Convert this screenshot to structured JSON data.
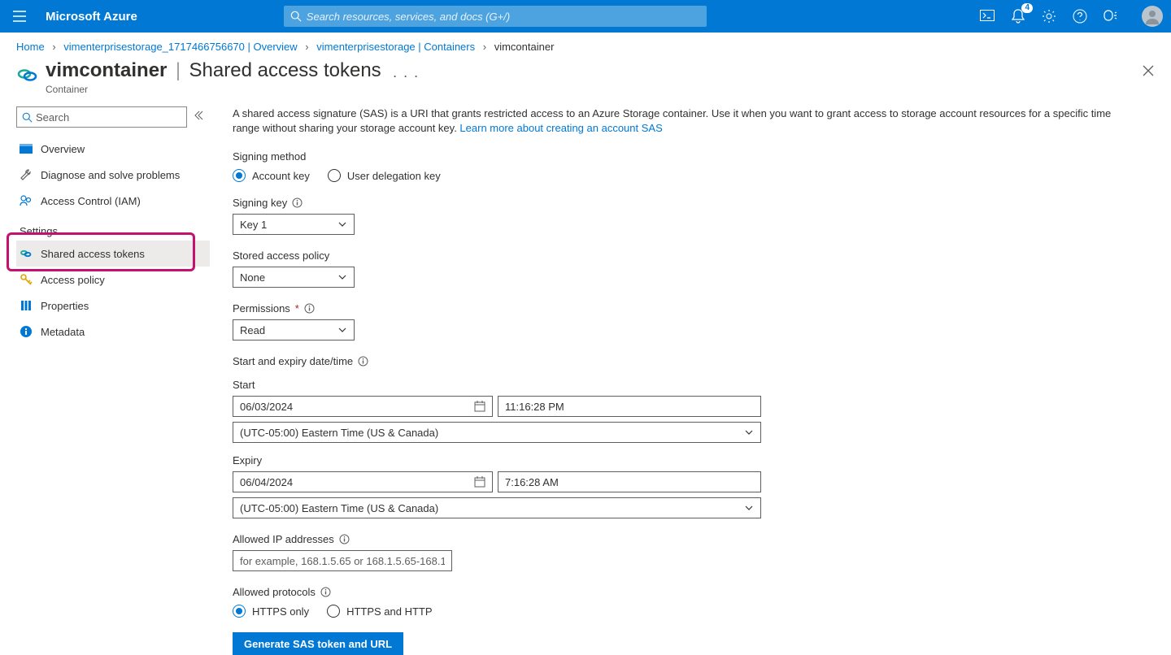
{
  "header": {
    "brand": "Microsoft Azure",
    "search_placeholder": "Search resources, services, and docs (G+/)",
    "notification_count": "4"
  },
  "breadcrumb": {
    "items": [
      "Home",
      "vimenterprisestorage_1717466756670 | Overview",
      "vimenterprisestorage | Containers",
      "vimcontainer"
    ]
  },
  "title": {
    "resource": "vimcontainer",
    "page": "Shared access tokens",
    "subtitle": "Container"
  },
  "sidebar": {
    "search_placeholder": "Search",
    "items_top": [
      {
        "label": "Overview"
      },
      {
        "label": "Diagnose and solve problems"
      },
      {
        "label": "Access Control (IAM)"
      }
    ],
    "group_label": "Settings",
    "items_settings": [
      {
        "label": "Shared access tokens"
      },
      {
        "label": "Access policy"
      },
      {
        "label": "Properties"
      },
      {
        "label": "Metadata"
      }
    ]
  },
  "main": {
    "help_text": "A shared access signature (SAS) is a URI that grants restricted access to an Azure Storage container. Use it when you want to grant access to storage account resources for a specific time range without sharing your storage account key. ",
    "help_link": "Learn more about creating an account SAS",
    "signing_method_label": "Signing method",
    "signing_method_options": [
      "Account key",
      "User delegation key"
    ],
    "signing_key_label": "Signing key",
    "signing_key_value": "Key 1",
    "stored_policy_label": "Stored access policy",
    "stored_policy_value": "None",
    "permissions_label": "Permissions",
    "permissions_value": "Read",
    "datetime_label": "Start and expiry date/time",
    "start_label": "Start",
    "start_date": "06/03/2024",
    "start_time": "11:16:28 PM",
    "start_tz": "(UTC-05:00) Eastern Time (US & Canada)",
    "expiry_label": "Expiry",
    "expiry_date": "06/04/2024",
    "expiry_time": "7:16:28 AM",
    "expiry_tz": "(UTC-05:00) Eastern Time (US & Canada)",
    "allowed_ip_label": "Allowed IP addresses",
    "allowed_ip_placeholder": "for example, 168.1.5.65 or 168.1.5.65-168.1....",
    "allowed_protocols_label": "Allowed protocols",
    "allowed_protocols_options": [
      "HTTPS only",
      "HTTPS and HTTP"
    ],
    "generate_button": "Generate SAS token and URL"
  }
}
